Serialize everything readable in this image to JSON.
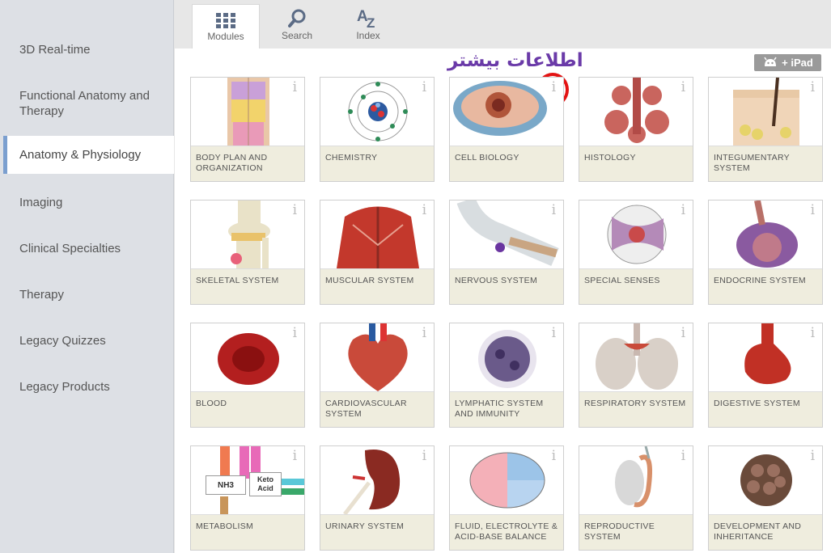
{
  "sidebar": {
    "items": [
      {
        "label": "3D Real-time"
      },
      {
        "label": "Functional Anatomy and Therapy"
      },
      {
        "label": "Anatomy & Physiology",
        "active": true
      },
      {
        "label": "Imaging"
      },
      {
        "label": "Clinical Specialties"
      },
      {
        "label": "Therapy"
      },
      {
        "label": "Legacy Quizzes"
      },
      {
        "label": "Legacy Products"
      }
    ]
  },
  "tabs": [
    {
      "label": "Modules",
      "icon": "grid-icon",
      "active": true
    },
    {
      "label": "Search",
      "icon": "search-icon"
    },
    {
      "label": "Index",
      "icon": "az-icon"
    }
  ],
  "platform_badge": {
    "label": "+ iPad",
    "icon": "android-icon"
  },
  "annotation": {
    "text": "اطلاعات بیشتر",
    "color": "#6a3aa8",
    "circle_color": "#e31313"
  },
  "info_symbol": "i",
  "modules": [
    {
      "label": "Body Plan and Organization",
      "icon": "torso-icon"
    },
    {
      "label": "Chemistry",
      "icon": "atom-icon"
    },
    {
      "label": "Cell Biology",
      "icon": "cell-icon"
    },
    {
      "label": "Histology",
      "icon": "gland-icon"
    },
    {
      "label": "Integumentary System",
      "icon": "skin-icon"
    },
    {
      "label": "Skeletal System",
      "icon": "knee-joint-icon"
    },
    {
      "label": "Muscular System",
      "icon": "back-muscles-icon"
    },
    {
      "label": "Nervous System",
      "icon": "nerve-fiber-icon"
    },
    {
      "label": "Special Senses",
      "icon": "eyeball-icon"
    },
    {
      "label": "Endocrine System",
      "icon": "thyroid-icon"
    },
    {
      "label": "Blood",
      "icon": "red-blood-cell-icon"
    },
    {
      "label": "Cardiovascular System",
      "icon": "heart-icon"
    },
    {
      "label": "Lymphatic System and Immunity",
      "icon": "lymphocyte-icon"
    },
    {
      "label": "Respiratory System",
      "icon": "lungs-icon"
    },
    {
      "label": "Digestive System",
      "icon": "stomach-icon"
    },
    {
      "label": "Metabolism",
      "icon": "metabolism-diagram-icon",
      "extra": {
        "nh3": "NH3",
        "keto": "Keto Acid"
      }
    },
    {
      "label": "Urinary System",
      "icon": "kidney-icon"
    },
    {
      "label": "Fluid, Electrolyte & Acid-Base Balance",
      "icon": "pie-diagram-icon"
    },
    {
      "label": "Reproductive System",
      "icon": "testis-icon"
    },
    {
      "label": "Development and Inheritance",
      "icon": "morula-icon"
    }
  ]
}
